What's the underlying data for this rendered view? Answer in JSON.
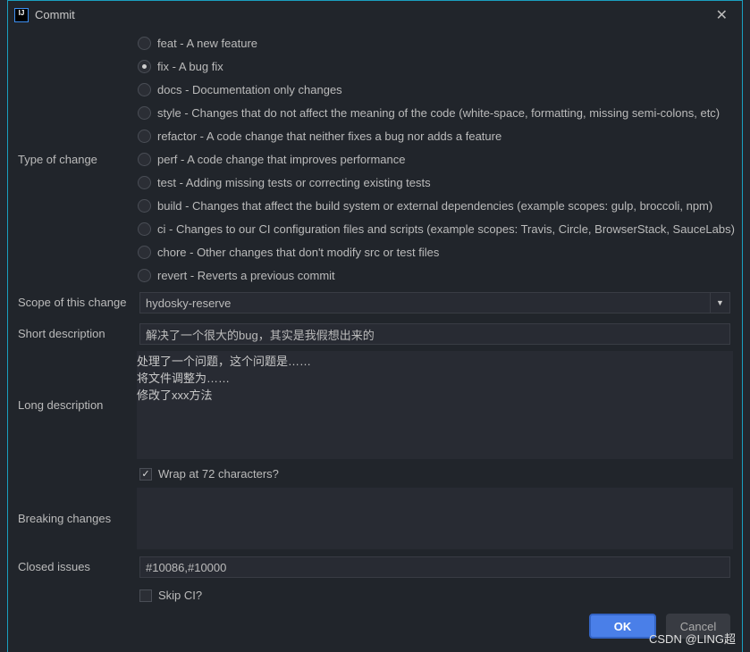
{
  "window": {
    "title": "Commit",
    "logo": "IJ"
  },
  "type_of_change": {
    "label": "Type of change",
    "selected": 1,
    "options": [
      "feat - A new feature",
      "fix - A bug fix",
      "docs - Documentation only changes",
      "style - Changes that do not affect the meaning of the code (white-space, formatting, missing semi-colons, etc)",
      "refactor - A code change that neither fixes a bug nor adds a feature",
      "perf - A code change that improves performance",
      "test - Adding missing tests or correcting existing tests",
      "build - Changes that affect the build system or external dependencies (example scopes: gulp, broccoli, npm)",
      "ci - Changes to our CI configuration files and scripts (example scopes: Travis, Circle, BrowserStack, SauceLabs)",
      "chore - Other changes that don't modify src or test files",
      "revert - Reverts a previous commit"
    ]
  },
  "scope": {
    "label": "Scope of this change",
    "value": "hydosky-reserve"
  },
  "short": {
    "label": "Short description",
    "value": "解决了一个很大的bug，其实是我假想出来的"
  },
  "long": {
    "label": "Long description",
    "lines": [
      "处理了一个问题，这个问题是……",
      "将文件调整为……",
      "修改了xxx方法"
    ]
  },
  "wrap": {
    "label": "Wrap at 72 characters?",
    "checked": true
  },
  "breaking": {
    "label": "Breaking changes",
    "value": ""
  },
  "closed": {
    "label": "Closed issues",
    "value": "#10086,#10000"
  },
  "skipci": {
    "label": "Skip CI?",
    "checked": false
  },
  "buttons": {
    "ok": "OK",
    "cancel": "Cancel"
  },
  "watermark": "CSDN @LING超"
}
